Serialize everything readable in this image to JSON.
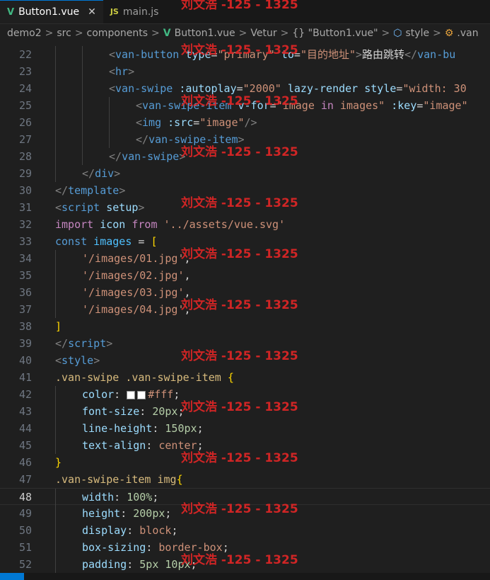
{
  "tabs": [
    {
      "icon": "V",
      "label": "Button1.vue",
      "close": "✕"
    },
    {
      "icon": "JS",
      "label": "main.js"
    }
  ],
  "breadcrumb": {
    "items": [
      "demo2",
      "src",
      "components",
      "Button1.vue",
      "Vetur",
      "{} \"Button1.vue\"",
      "style",
      ".van"
    ],
    "separator": ">"
  },
  "watermark": "刘文浩 -125 - 1325",
  "code": {
    "current_line": 48,
    "lines": [
      {
        "n": 22,
        "indent": 2,
        "tokens": [
          [
            "<",
            "pun"
          ],
          [
            "van-button",
            "tag"
          ],
          [
            " type",
            "attr"
          ],
          [
            "=",
            "txt"
          ],
          [
            "\"primary\"",
            "str"
          ],
          [
            " to",
            "attr"
          ],
          [
            "=",
            "txt"
          ],
          [
            "\"目的地址\"",
            "str"
          ],
          [
            ">",
            "pun"
          ],
          [
            "路由跳转",
            "txt"
          ],
          [
            "</",
            "pun"
          ],
          [
            "van-bu",
            "tag"
          ]
        ]
      },
      {
        "n": 23,
        "indent": 2,
        "tokens": [
          [
            "<",
            "pun"
          ],
          [
            "hr",
            "tag"
          ],
          [
            ">",
            "pun"
          ]
        ]
      },
      {
        "n": 24,
        "indent": 2,
        "tokens": [
          [
            "<",
            "pun"
          ],
          [
            "van-swipe",
            "tag"
          ],
          [
            " :autoplay",
            "attr"
          ],
          [
            "=",
            "txt"
          ],
          [
            "\"2000\"",
            "str"
          ],
          [
            " lazy-render",
            "attr"
          ],
          [
            " style",
            "attr"
          ],
          [
            "=",
            "txt"
          ],
          [
            "\"width: 30",
            "str"
          ]
        ]
      },
      {
        "n": 25,
        "indent": 3,
        "tokens": [
          [
            "<",
            "pun"
          ],
          [
            "van-swipe-item",
            "tag"
          ],
          [
            " v-for",
            "attr"
          ],
          [
            "=",
            "txt"
          ],
          [
            "\"image ",
            "str"
          ],
          [
            "in",
            "kw"
          ],
          [
            " images\"",
            "str"
          ],
          [
            " :key",
            "attr"
          ],
          [
            "=",
            "txt"
          ],
          [
            "\"image\"",
            "str"
          ]
        ]
      },
      {
        "n": 26,
        "indent": 3,
        "tokens": [
          [
            "<",
            "pun"
          ],
          [
            "img",
            "tag"
          ],
          [
            " :src",
            "attr"
          ],
          [
            "=",
            "txt"
          ],
          [
            "\"image\"",
            "str"
          ],
          [
            "/>",
            "pun"
          ]
        ]
      },
      {
        "n": 27,
        "indent": 3,
        "tokens": [
          [
            "</",
            "pun"
          ],
          [
            "van-swipe-item",
            "tag"
          ],
          [
            ">",
            "pun"
          ]
        ]
      },
      {
        "n": 28,
        "indent": 2,
        "tokens": [
          [
            "</",
            "pun"
          ],
          [
            "van-swipe",
            "tag"
          ],
          [
            ">",
            "pun"
          ]
        ]
      },
      {
        "n": 29,
        "indent": 1,
        "tokens": [
          [
            "</",
            "pun"
          ],
          [
            "div",
            "tag"
          ],
          [
            ">",
            "pun"
          ]
        ]
      },
      {
        "n": 30,
        "indent": 0,
        "tokens": [
          [
            "</",
            "pun"
          ],
          [
            "template",
            "tag"
          ],
          [
            ">",
            "pun"
          ]
        ]
      },
      {
        "n": 31,
        "indent": 0,
        "tokens": [
          [
            "<",
            "pun"
          ],
          [
            "script",
            "tag"
          ],
          [
            " setup",
            "attr"
          ],
          [
            ">",
            "pun"
          ]
        ]
      },
      {
        "n": 32,
        "indent": 0,
        "tokens": [
          [
            "import",
            "kw"
          ],
          [
            " icon ",
            "var2"
          ],
          [
            "from",
            "kw"
          ],
          [
            " '../assets/vue.svg'",
            "str"
          ]
        ]
      },
      {
        "n": 33,
        "indent": 0,
        "tokens": [
          [
            "const",
            "dec"
          ],
          [
            " images",
            "var"
          ],
          [
            " = ",
            "txt"
          ],
          [
            "[",
            "brk"
          ]
        ]
      },
      {
        "n": 34,
        "indent": 1,
        "tokens": [
          [
            "'/images/01.jpg'",
            "str"
          ],
          [
            ",",
            "txt"
          ]
        ]
      },
      {
        "n": 35,
        "indent": 1,
        "tokens": [
          [
            "'/images/02.jpg'",
            "str"
          ],
          [
            ",",
            "txt"
          ]
        ]
      },
      {
        "n": 36,
        "indent": 1,
        "tokens": [
          [
            "'/images/03.jpg'",
            "str"
          ],
          [
            ",",
            "txt"
          ]
        ]
      },
      {
        "n": 37,
        "indent": 1,
        "tokens": [
          [
            "'/images/04.jpg'",
            "str"
          ],
          [
            ",",
            "txt"
          ]
        ]
      },
      {
        "n": 38,
        "indent": 0,
        "tokens": [
          [
            "]",
            "brk"
          ]
        ]
      },
      {
        "n": 39,
        "indent": 0,
        "tokens": [
          [
            "</",
            "pun"
          ],
          [
            "script",
            "tag"
          ],
          [
            ">",
            "pun"
          ]
        ]
      },
      {
        "n": 40,
        "indent": 0,
        "tokens": [
          [
            "<",
            "pun"
          ],
          [
            "style",
            "tag"
          ],
          [
            ">",
            "pun"
          ]
        ]
      },
      {
        "n": 41,
        "indent": 0,
        "tokens": [
          [
            ".van-swipe .van-swipe-item ",
            "sel"
          ],
          [
            "{",
            "brk"
          ]
        ]
      },
      {
        "n": 42,
        "indent": 1,
        "swatch": true,
        "tokens": [
          [
            "color",
            "prop"
          ],
          [
            ": ",
            "txt"
          ],
          [
            "SWATCH",
            "swatch"
          ],
          [
            "#fff",
            "val"
          ],
          [
            ";",
            "txt"
          ]
        ]
      },
      {
        "n": 43,
        "indent": 1,
        "tokens": [
          [
            "font-size",
            "prop"
          ],
          [
            ": ",
            "txt"
          ],
          [
            "20px",
            "num"
          ],
          [
            ";",
            "txt"
          ]
        ]
      },
      {
        "n": 44,
        "indent": 1,
        "tokens": [
          [
            "line-height",
            "prop"
          ],
          [
            ": ",
            "txt"
          ],
          [
            "150px",
            "num"
          ],
          [
            ";",
            "txt"
          ]
        ]
      },
      {
        "n": 45,
        "indent": 1,
        "tokens": [
          [
            "text-align",
            "prop"
          ],
          [
            ": ",
            "txt"
          ],
          [
            "center",
            "val"
          ],
          [
            ";",
            "txt"
          ]
        ]
      },
      {
        "n": 46,
        "indent": 0,
        "tokens": [
          [
            "}",
            "brk"
          ]
        ]
      },
      {
        "n": 47,
        "indent": 0,
        "tokens": [
          [
            ".van-swipe-item img",
            "sel"
          ],
          [
            "{",
            "brk"
          ]
        ]
      },
      {
        "n": 48,
        "indent": 1,
        "tokens": [
          [
            "width",
            "prop"
          ],
          [
            ": ",
            "txt"
          ],
          [
            "100%",
            "num"
          ],
          [
            ";",
            "txt"
          ]
        ]
      },
      {
        "n": 49,
        "indent": 1,
        "tokens": [
          [
            "height",
            "prop"
          ],
          [
            ": ",
            "txt"
          ],
          [
            "200px",
            "num"
          ],
          [
            ";",
            "txt"
          ]
        ]
      },
      {
        "n": 50,
        "indent": 1,
        "tokens": [
          [
            "display",
            "prop"
          ],
          [
            ": ",
            "txt"
          ],
          [
            "block",
            "val"
          ],
          [
            ";",
            "txt"
          ]
        ]
      },
      {
        "n": 51,
        "indent": 1,
        "tokens": [
          [
            "box-sizing",
            "prop"
          ],
          [
            ": ",
            "txt"
          ],
          [
            "border-box",
            "val"
          ],
          [
            ";",
            "txt"
          ]
        ]
      },
      {
        "n": 52,
        "indent": 1,
        "tokens": [
          [
            "padding",
            "prop"
          ],
          [
            ": ",
            "txt"
          ],
          [
            "5px 10px",
            "num"
          ],
          [
            ";",
            "txt"
          ]
        ]
      }
    ]
  },
  "watermark_lines": [
    22,
    25,
    28,
    31,
    34,
    37,
    40,
    43,
    46,
    49,
    52
  ]
}
